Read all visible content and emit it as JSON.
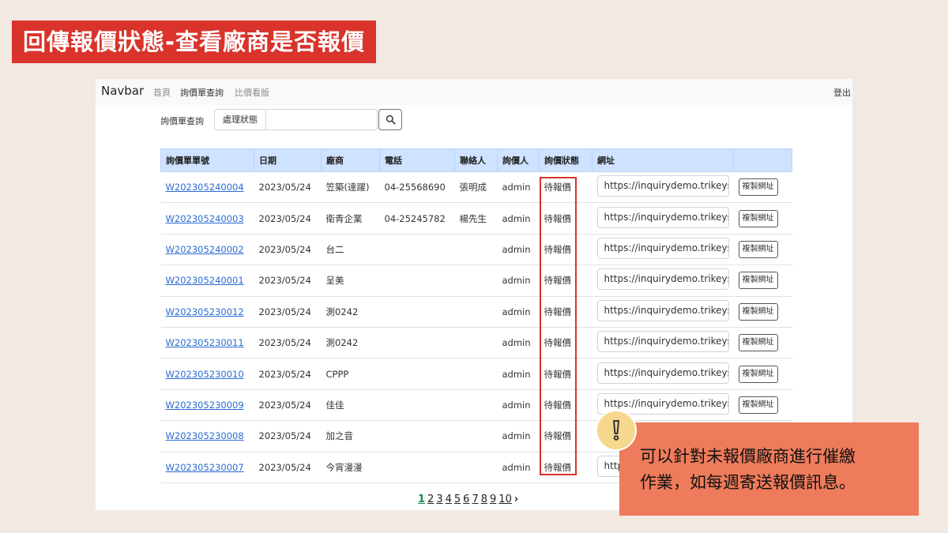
{
  "slide": {
    "title": "回傳報價狀態-查看廠商是否報價"
  },
  "navbar": {
    "brand": "Navbar",
    "items": [
      {
        "label": "首頁"
      },
      {
        "label": "詢價單查詢"
      },
      {
        "label": "比價看版"
      }
    ],
    "logout": "登出"
  },
  "search": {
    "label": "詢價單查詢",
    "prefix": "處理狀態",
    "value": "",
    "button_icon": "search-icon"
  },
  "table": {
    "headers": [
      "詢價單單號",
      "日期",
      "廠商",
      "電話",
      "聯絡人",
      "詢價人",
      "詢價狀態",
      "網址",
      ""
    ],
    "copy_label": "複製網址",
    "rows": [
      {
        "id": "W202305240004",
        "date": "2023/05/24",
        "vendor": "笠築(達躍)",
        "phone": "04-25568690",
        "contact": "張明成",
        "requester": "admin",
        "status": "待報價",
        "url": "https://inquirydemo.trikeys."
      },
      {
        "id": "W202305240003",
        "date": "2023/05/24",
        "vendor": "衛青企業",
        "phone": "04-25245782",
        "contact": "楊先生",
        "requester": "admin",
        "status": "待報價",
        "url": "https://inquirydemo.trikeys."
      },
      {
        "id": "W202305240002",
        "date": "2023/05/24",
        "vendor": "台二",
        "phone": "",
        "contact": "",
        "requester": "admin",
        "status": "待報價",
        "url": "https://inquirydemo.trikeys."
      },
      {
        "id": "W202305240001",
        "date": "2023/05/24",
        "vendor": "呈美",
        "phone": "",
        "contact": "",
        "requester": "admin",
        "status": "待報價",
        "url": "https://inquirydemo.trikeys."
      },
      {
        "id": "W202305230012",
        "date": "2023/05/24",
        "vendor": "測0242",
        "phone": "",
        "contact": "",
        "requester": "admin",
        "status": "待報價",
        "url": "https://inquirydemo.trikeys."
      },
      {
        "id": "W202305230011",
        "date": "2023/05/24",
        "vendor": "測0242",
        "phone": "",
        "contact": "",
        "requester": "admin",
        "status": "待報價",
        "url": "https://inquirydemo.trikeys."
      },
      {
        "id": "W202305230010",
        "date": "2023/05/24",
        "vendor": "CPPP",
        "phone": "",
        "contact": "",
        "requester": "admin",
        "status": "待報價",
        "url": "https://inquirydemo.trikeys."
      },
      {
        "id": "W202305230009",
        "date": "2023/05/24",
        "vendor": "佳佳",
        "phone": "",
        "contact": "",
        "requester": "admin",
        "status": "待報價",
        "url": "https://inquirydemo.trikeys."
      },
      {
        "id": "W202305230008",
        "date": "2023/05/24",
        "vendor": "加之音",
        "phone": "",
        "contact": "",
        "requester": "admin",
        "status": "待報價",
        "url": ""
      },
      {
        "id": "W202305230007",
        "date": "2023/05/24",
        "vendor": "今宵漫漫",
        "phone": "",
        "contact": "",
        "requester": "admin",
        "status": "待報價",
        "url": "http"
      }
    ]
  },
  "pagination": {
    "pages": [
      "1",
      "2",
      "3",
      "4",
      "5",
      "6",
      "7",
      "8",
      "9",
      "10"
    ],
    "current": "1",
    "next": "›"
  },
  "callout": {
    "line1": "可以針對未報價廠商進行催繳",
    "line2": "作業，如每週寄送報價訊息。",
    "icon": "exclamation-icon"
  },
  "colors": {
    "title_bg": "#d9332b",
    "highlight": "#d9332b",
    "callout_bg": "#ee7b5b",
    "header_bg": "#cfe2ff",
    "link": "#2a6bd1",
    "page_active": "#198754"
  }
}
